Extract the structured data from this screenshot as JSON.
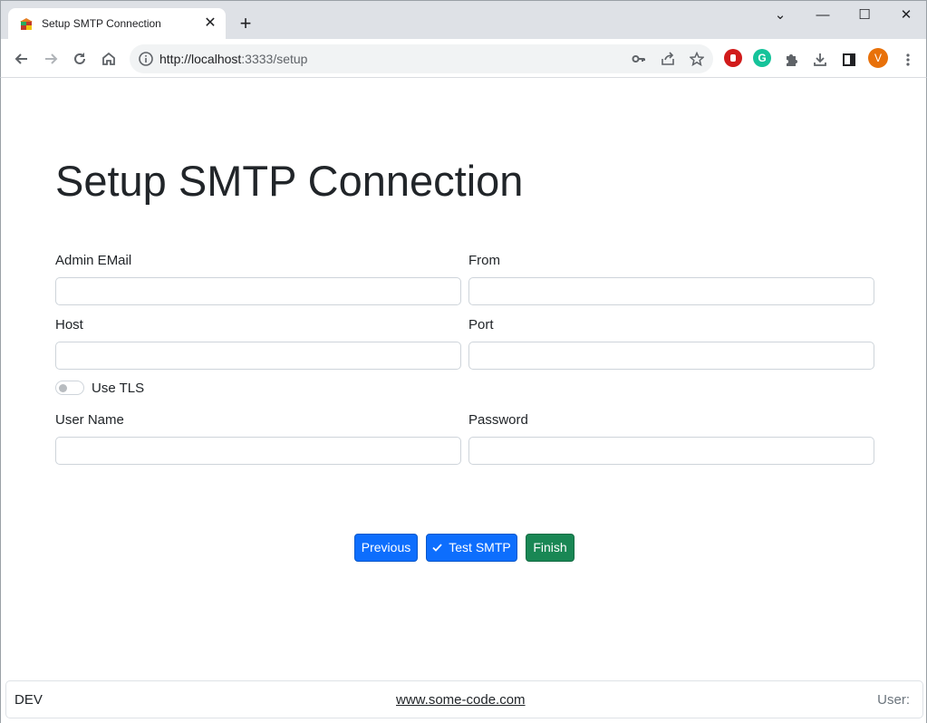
{
  "browser": {
    "tab_title": "Setup SMTP Connection",
    "tab_close": "✕",
    "new_tab": "+",
    "window_controls": {
      "dropdown": "⌄",
      "minimize": "—",
      "maximize": "☐",
      "close": "✕"
    },
    "url_host": "http://localhost",
    "url_rest": ":3333/setup",
    "avatar_initial": "V",
    "icons": [
      "back-icon",
      "forward-icon",
      "reload-icon",
      "home-icon",
      "info-icon",
      "key-icon",
      "share-icon",
      "star-icon",
      "adblock-icon",
      "grammarly-icon",
      "extensions-icon",
      "download-icon",
      "sidepanel-icon",
      "menu-icon"
    ]
  },
  "page": {
    "title": "Setup SMTP Connection",
    "fields": {
      "admin_email": {
        "label": "Admin EMail",
        "value": ""
      },
      "from": {
        "label": "From",
        "value": ""
      },
      "host": {
        "label": "Host",
        "value": ""
      },
      "port": {
        "label": "Port",
        "value": ""
      },
      "user_name": {
        "label": "User Name",
        "value": ""
      },
      "password": {
        "label": "Password",
        "value": ""
      }
    },
    "use_tls": {
      "label": "Use TLS",
      "checked": false
    },
    "buttons": {
      "previous": "Previous",
      "test_smtp": "Test SMTP",
      "finish": "Finish"
    },
    "colors": {
      "primary": "#0d6efd",
      "success": "#198754"
    }
  },
  "footer": {
    "left": "DEV",
    "link": "www.some-code.com",
    "right": "User:"
  }
}
